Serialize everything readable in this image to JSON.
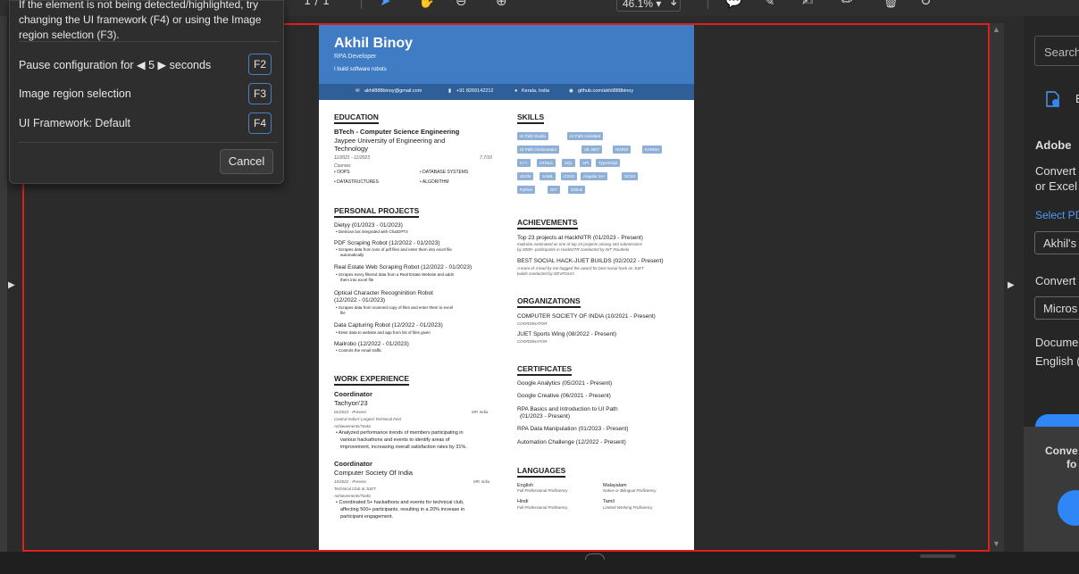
{
  "toolbar": {
    "page_indicator": "1 / 1",
    "zoom": "46.1%"
  },
  "popup": {
    "intro_line1": "If the element is not being detected/highlighted, try",
    "intro_line2": "changing the UI framework (F4) or using the Image",
    "intro_line3": "region selection (F3).",
    "pause_label": "Pause configuration for",
    "pause_value": "◀ 5 ▶",
    "pause_unit": "seconds",
    "pause_key": "F2",
    "image_region_label": "Image region selection",
    "image_region_key": "F3",
    "framework_label": "UI Framework: Default",
    "framework_key": "F4",
    "cancel_label": "Cancel"
  },
  "resume": {
    "name": "Akhil Binoy",
    "role": "RPA Developer",
    "tagline": "I build software robots",
    "email": "akhil888binoy@gmail.com",
    "phone": "+91 8269142212",
    "location": "Kerala, India",
    "github": "github.com/akhil888binoy",
    "education": {
      "heading": "EDUCATION",
      "degree": "BTech - Computer Science Engineering",
      "school_line1": "Jaypee University of Engineering and",
      "school_line2": "Technology",
      "dates": "11/2021 - 11/2023",
      "gpa": "7.7/10",
      "courses_label": "Courses",
      "courses": [
        "OOPS",
        "DATABASE SYSTEMS",
        "DATASTRUCTURES",
        "ALGORITHM"
      ]
    },
    "projects": {
      "heading": "PERSONAL PROJECTS",
      "items": [
        {
          "title": "Dietyy (01/2023 - 01/2023)",
          "desc": "Dietician bot integrated with ChatGPT3"
        },
        {
          "title": "PDF Scraping Robot (12/2022 - 01/2023)",
          "desc": "Scrapes data from tons of pdf files and enter them into excel file",
          "desc2": "automatically"
        },
        {
          "title": "Real Estate Web Scraping Robot (12/2022 - 01/2023)",
          "desc": "Scrapes every filtered data from a Real Estate Website and adds",
          "desc2": "them into excel file"
        },
        {
          "title": "Optical Character Recogninition Robot",
          "title2": "(12/2022 - 01/2023)",
          "desc": "Scrapes data from scanned copy of files and enter them to excel",
          "desc2": "file"
        },
        {
          "title": "Data Capturing Robot (12/2022 - 01/2023)",
          "desc": "Enter data to website and app from list of files given"
        },
        {
          "title": "Mailrobo (12/2022 - 01/2023)",
          "desc": "Controls the email traffic"
        }
      ]
    },
    "work": {
      "heading": "WORK EXPERIENCE",
      "jobs": [
        {
          "role": "Coordinator",
          "org": "Tachyon'23",
          "dates": "01/2023 - Present",
          "place": "MP, India",
          "sub": "Central India's Largest Technical Fest",
          "tasks_label": "Achievements/Tasks",
          "tasks": [
            "Analyzed performance trends of members participating in",
            "various hackathons and events to identify areas of",
            "improvement, increasing overall satisfaction rates by 31%."
          ]
        },
        {
          "role": "Coordinator",
          "org": "Computer Society Of India",
          "dates": "10/2022 - Present",
          "place": "MP, India",
          "sub": "Technical Club at JUET",
          "tasks_label": "Achievements/Tasks",
          "tasks": [
            "Coordinated 5+ hackathons and events for technical club,",
            "affecting 500+ participants, resulting in a 20% increase in",
            "participant engagement."
          ]
        }
      ]
    },
    "skills": {
      "heading": "SKILLS",
      "rows": [
        [
          "UI Path Studio",
          "UI Path Assistant"
        ],
        [
          "UI Path Orchestrator",
          "Vb .NET",
          "NGINX",
          "KARMA"
        ],
        [
          "C++",
          "HTML5",
          "SQL",
          "API",
          "TypeScript"
        ],
        [
          "JSON",
          "XAML",
          "CSS3",
          "Angular 14+",
          "SCSS"
        ],
        [
          "Python",
          "GIT",
          "Github"
        ]
      ]
    },
    "achievements": {
      "heading": "ACHIEVEMENTS",
      "items": [
        {
          "title": "Top 23 projects at HackNITR (01/2023 - Present)",
          "desc": "mailrobo nominated as one of top 23 projects among 343 submissions",
          "desc2": "by 3000+ participants in HackNITR conducted by NIT Rourkela"
        },
        {
          "title": "BEST SOCIAL HACK-JUET BUILDS (02/2022 - Present)",
          "desc": "A team of 4 lead by me bagged the award for best social hack on JUET",
          "desc2": "builds conducted by DEVFOLIO"
        }
      ]
    },
    "organizations": {
      "heading": "ORGANIZATIONS",
      "items": [
        {
          "title": "COMPUTER SOCIETY OF INDIA (10/2021 - Present)",
          "role": "COORDINATOR"
        },
        {
          "title": "JUET Sports Wing (08/2022 - Present)",
          "role": "COORDINATOR"
        }
      ]
    },
    "certificates": {
      "heading": "CERTIFICATES",
      "items": [
        "Google Analytics (05/2021 - Present)",
        "Google Creative (06/2021 - Present)",
        "RPA Basics and Introduction to UI Path",
        "(01/2023 - Present)",
        "RPA Data Manipulation (01/2023 - Present)",
        "Automation Challenge (12/2022 - Present)"
      ]
    },
    "languages": {
      "heading": "LANGUAGES",
      "items": [
        {
          "name": "English",
          "level": "Full Professional Proficiency"
        },
        {
          "name": "Malayalam",
          "level": "Native or Bilingual Proficiency"
        },
        {
          "name": "Hindi",
          "level": "Full Professional Proficiency"
        },
        {
          "name": "Tamil",
          "level": "Limited Working Proficiency"
        }
      ]
    }
  },
  "right_panel": {
    "search_placeholder": "Search",
    "tool_label": "E",
    "title": "Adobe",
    "desc1": "Convert",
    "desc2": "or Excel",
    "select_link": "Select PD",
    "file_value": "Akhil's",
    "convert_label": "Convert",
    "format_value": "Micros",
    "doc_label": "Docume",
    "lang_value": "English (",
    "bottom_text1": "Conve",
    "bottom_text2": "fo"
  },
  "colors": {
    "header_blue": "#3f7cc4",
    "contact_blue": "#2f5f99",
    "selection_red": "#e01e1e",
    "accent_blue": "#2f86f6"
  }
}
